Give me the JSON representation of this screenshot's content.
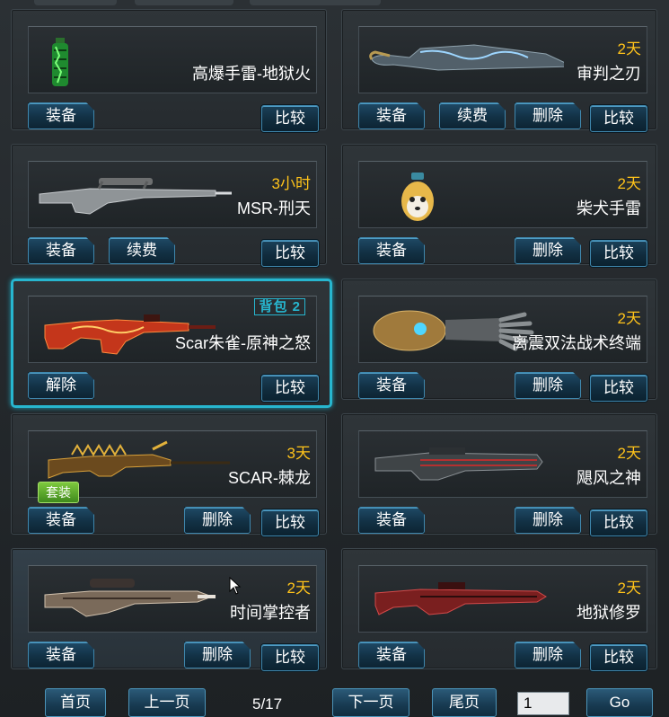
{
  "items": [
    {
      "key": "grenade-hellfire",
      "name": "高爆手雷-地狱火",
      "duration": "",
      "buttons": [
        "equip",
        "compare"
      ],
      "tag": ""
    },
    {
      "key": "blade-judgment",
      "name": "审判之刃",
      "duration": "2天",
      "buttons": [
        "equip",
        "renew",
        "delete",
        "compare"
      ],
      "tag": ""
    },
    {
      "key": "msr-xingtian",
      "name": "MSR-刑天",
      "duration": "3小时",
      "buttons": [
        "equip",
        "renew",
        "compare"
      ],
      "tag": ""
    },
    {
      "key": "shiba-grenade",
      "name": "柴犬手雷",
      "duration": "2天",
      "buttons": [
        "equip",
        "delete",
        "compare"
      ],
      "tag": ""
    },
    {
      "key": "scar-suzaku",
      "name": "Scar朱雀-原神之怒",
      "duration": "",
      "buttons": [
        "unequip",
        "compare"
      ],
      "tag": "背包 2"
    },
    {
      "key": "lizhen-gauntlet",
      "name": "离震双法战术终端",
      "duration": "2天",
      "buttons": [
        "equip",
        "delete",
        "compare"
      ],
      "tag": ""
    },
    {
      "key": "scar-thorn-dragon",
      "name": "SCAR-棘龙",
      "duration": "3天",
      "buttons": [
        "equip",
        "delete",
        "compare"
      ],
      "tag": "套装"
    },
    {
      "key": "hurricane-god",
      "name": "飓风之神",
      "duration": "2天",
      "buttons": [
        "equip",
        "delete",
        "compare"
      ],
      "tag": ""
    },
    {
      "key": "time-controller",
      "name": "时间掌控者",
      "duration": "2天",
      "buttons": [
        "equip",
        "delete",
        "compare"
      ],
      "tag": ""
    },
    {
      "key": "hell-asura",
      "name": "地狱修罗",
      "duration": "2天",
      "buttons": [
        "equip",
        "delete",
        "compare"
      ],
      "tag": ""
    }
  ],
  "labels": {
    "equip": "装备",
    "unequip": "解除",
    "renew": "续费",
    "delete": "删除",
    "compare": "比较",
    "bag_tag": "背包 2",
    "suit_tag": "套装"
  },
  "pagination": {
    "first": "首页",
    "prev": "上一页",
    "page_indicator": "5/17",
    "next": "下一页",
    "last": "尾页",
    "page_input": "1",
    "go": "Go"
  },
  "colors": {
    "duration": "#ffc31a",
    "selected_border": "#27b6cf",
    "button_border": "#3f87ad",
    "suit_tag": "#5aa82c"
  }
}
